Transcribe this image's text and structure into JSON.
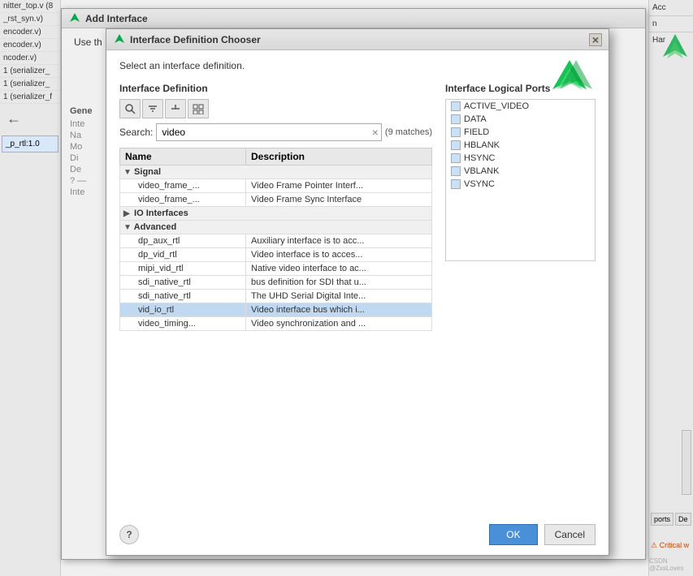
{
  "background": {
    "sidebar_items": [
      "nitter_top.v (8",
      "_rst_syn.v)",
      "encoder.v)",
      "encoder.v)",
      "ncoder.v)",
      "1 (serializer_",
      "1 (serializer_",
      "1 (serializer_f"
    ],
    "right_panel_labels": [
      "Acc",
      "n",
      "Har"
    ]
  },
  "add_interface": {
    "title": "Add Interface",
    "body_text": "Use th"
  },
  "chooser": {
    "title": "Interface Definition Chooser",
    "close_label": "×",
    "subtitle": "Select an interface definition.",
    "left_panel": {
      "title": "Interface Definition",
      "toolbar_buttons": [
        "search",
        "filter",
        "collapse",
        "expand"
      ],
      "search_label": "Search:",
      "search_value": "video",
      "search_matches": "(9 matches)",
      "table": {
        "columns": [
          "Name",
          "Description"
        ],
        "groups": [
          {
            "name": "Signal",
            "expanded": true,
            "children": [
              {
                "name": "video_frame_...",
                "description": "Video Frame Pointer Interf..."
              },
              {
                "name": "video_frame_...",
                "description": "Video Frame Sync Interface"
              }
            ]
          },
          {
            "name": "IO Interfaces",
            "expanded": false,
            "children": []
          },
          {
            "name": "Advanced",
            "expanded": true,
            "children": [
              {
                "name": "dp_aux_rtl",
                "description": "Auxiliary interface is to acc..."
              },
              {
                "name": "dp_vid_rtl",
                "description": "Video interface is to acces..."
              },
              {
                "name": "mipi_vid_rtl",
                "description": "Native video interface to ac..."
              },
              {
                "name": "sdi_native_rtl",
                "description": "bus definition for SDI that u..."
              },
              {
                "name": "sdi_native_rtl",
                "description": "The UHD Serial Digital Inte..."
              },
              {
                "name": "vid_io_rtl",
                "description": "Video interface bus which i...",
                "selected": true
              },
              {
                "name": "video_timing...",
                "description": "Video synchronization and ..."
              }
            ]
          }
        ]
      }
    },
    "right_panel": {
      "title": "Interface Logical Ports",
      "ports": [
        "ACTIVE_VIDEO",
        "DATA",
        "FIELD",
        "HBLANK",
        "HSYNC",
        "VBLANK",
        "VSYNC"
      ]
    },
    "footer": {
      "help_label": "?",
      "ok_label": "OK",
      "cancel_label": "Cancel"
    }
  }
}
